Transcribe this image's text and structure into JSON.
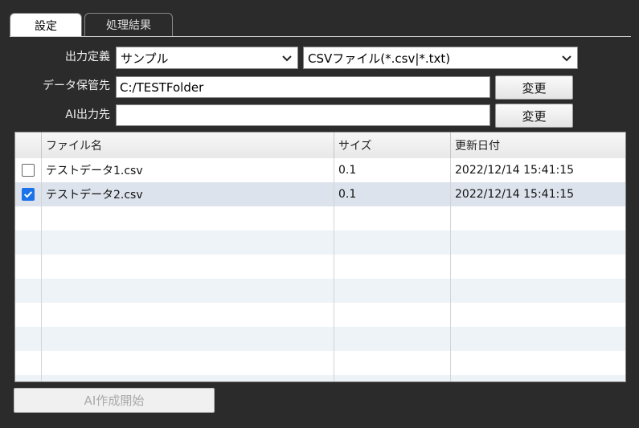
{
  "tabs": [
    {
      "label": "設定",
      "active": true
    },
    {
      "label": "処理結果",
      "active": false
    }
  ],
  "form": {
    "output_def_label": "出力定義",
    "output_def_value": "サンプル",
    "file_type_value": "CSVファイル(*.csv|*.txt)",
    "data_store_label": "データ保管先",
    "data_store_value": "C:/TESTFolder",
    "ai_output_label": "AI出力先",
    "ai_output_value": "",
    "change_label_1": "変更",
    "change_label_2": "変更"
  },
  "table": {
    "headers": [
      "ファイル名",
      "サイズ",
      "更新日付"
    ],
    "rows": [
      {
        "checked": false,
        "name": "テストデータ1.csv",
        "size": "0.1",
        "date": "2022/12/14 15:41:15"
      },
      {
        "checked": true,
        "name": "テストデータ2.csv",
        "size": "0.1",
        "date": "2022/12/14 15:41:15"
      }
    ]
  },
  "start_button_label": "AI作成開始",
  "colors": {
    "background": "#2b2b2b",
    "selected_row": "#dde3ec",
    "alt_row": "#eef3f8",
    "checkbox_accent": "#1a73e8"
  },
  "icons": [
    "chevron-down-icon",
    "checkmark-icon"
  ]
}
